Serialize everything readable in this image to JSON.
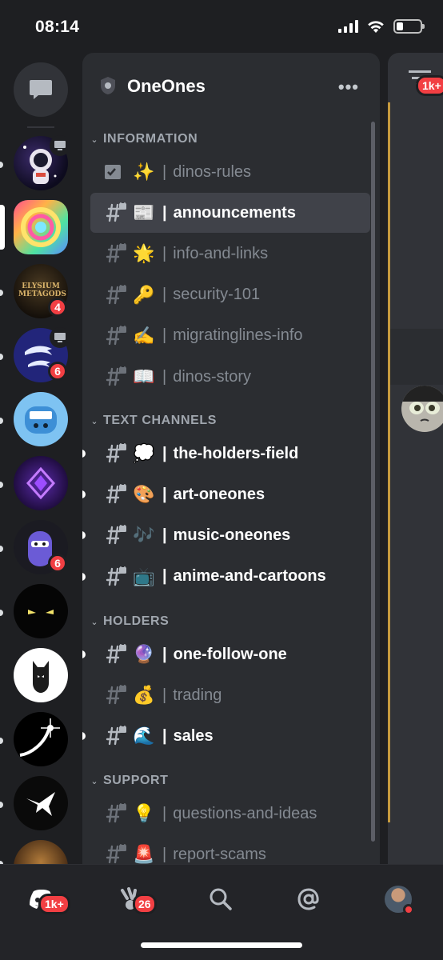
{
  "status_bar": {
    "time": "08:14",
    "battery_level": 0.3
  },
  "server": {
    "name": "OneOnes",
    "more_label": "•••"
  },
  "rail": {
    "servers": [
      {
        "name": "astronaut-server",
        "badge": "",
        "voice": true,
        "unread": true
      },
      {
        "name": "rainbow-server",
        "badge": "",
        "selected": true
      },
      {
        "name": "Elysium Metagods",
        "text": "ELYSIUM METAGODS",
        "badge": "4",
        "unread": true
      },
      {
        "name": "dolphin-server",
        "badge": "6",
        "voice": true,
        "unread": true
      },
      {
        "name": "monster-server",
        "badge": "",
        "unread": true
      },
      {
        "name": "purple-logo-server",
        "badge": "",
        "unread": true
      },
      {
        "name": "ninja-server",
        "badge": "6",
        "unread": true
      },
      {
        "name": "eyes-server",
        "badge": "",
        "unread": true
      },
      {
        "name": "mask-server",
        "badge": ""
      },
      {
        "name": "comet-server",
        "badge": "",
        "unread": true
      },
      {
        "name": "bird-server",
        "badge": "",
        "unread": true
      },
      {
        "name": "partial-server",
        "badge": "",
        "unread": true
      }
    ]
  },
  "categories": [
    {
      "label": "INFORMATION",
      "channels": [
        {
          "emoji": "✨",
          "name": "dinos-rules",
          "state": "muted",
          "icon": "rules-icon"
        },
        {
          "emoji": "📰",
          "name": "announcements",
          "state": "active",
          "icon": "locked-hash-icon"
        },
        {
          "emoji": "🌟",
          "name": "info-and-links",
          "state": "muted",
          "icon": "locked-hash-icon"
        },
        {
          "emoji": "🔑",
          "name": "security-101",
          "state": "muted",
          "icon": "locked-hash-icon"
        },
        {
          "emoji": "✍️",
          "name": "migratinglines-info",
          "state": "muted",
          "icon": "locked-hash-icon"
        },
        {
          "emoji": "📖",
          "name": "dinos-story",
          "state": "muted",
          "icon": "locked-hash-icon"
        }
      ]
    },
    {
      "label": "TEXT CHANNELS",
      "channels": [
        {
          "emoji": "💭",
          "name": "the-holders-field",
          "state": "unread",
          "icon": "locked-hash-icon"
        },
        {
          "emoji": "🎨",
          "name": "art-oneones",
          "state": "unread",
          "icon": "locked-hash-icon"
        },
        {
          "emoji": "🎶",
          "name": "music-oneones",
          "state": "unread",
          "icon": "locked-hash-icon"
        },
        {
          "emoji": "📺",
          "name": "anime-and-cartoons",
          "state": "unread",
          "icon": "locked-hash-icon"
        }
      ]
    },
    {
      "label": "HOLDERS",
      "channels": [
        {
          "emoji": "🔮",
          "name": "one-follow-one",
          "state": "unread",
          "icon": "locked-hash-icon"
        },
        {
          "emoji": "💰",
          "name": "trading",
          "state": "muted",
          "icon": "locked-hash-icon"
        },
        {
          "emoji": "🌊",
          "name": "sales",
          "state": "unread",
          "icon": "locked-hash-icon"
        }
      ]
    },
    {
      "label": "SUPPORT",
      "channels": [
        {
          "emoji": "💡",
          "name": "questions-and-ideas",
          "state": "muted",
          "icon": "locked-hash-icon"
        },
        {
          "emoji": "🚨",
          "name": "report-scams",
          "state": "muted",
          "icon": "locked-hash-icon"
        }
      ]
    }
  ],
  "pipe": "|",
  "peek": {
    "badge": "1k+"
  },
  "nav": {
    "home_badge": "1k+",
    "friends_badge": "26",
    "items": [
      "home",
      "friends",
      "search",
      "mentions",
      "profile"
    ]
  },
  "colors": {
    "background": "#1e1f22",
    "panel": "#2b2d31",
    "active_row": "#404249",
    "badge": "#f23f43",
    "muted_text": "#848a92",
    "accent_gold": "#c59a3e"
  }
}
